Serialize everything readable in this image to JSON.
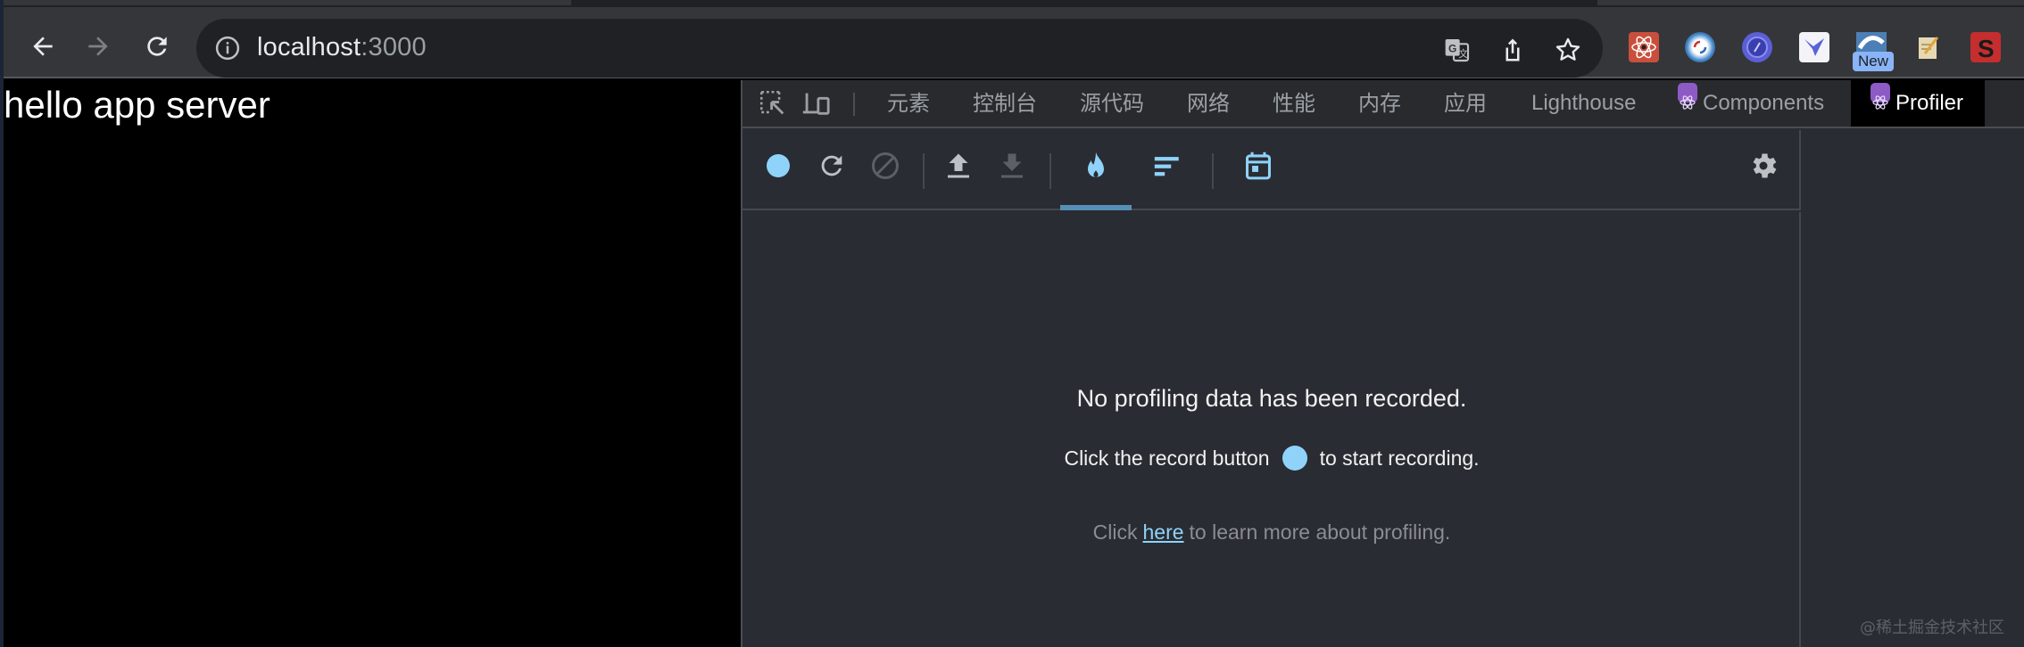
{
  "browser": {
    "url_host": "localhost",
    "url_port": ":3000",
    "nav": {
      "back": "arrow-left-icon",
      "forward": "arrow-right-icon",
      "reload": "reload-icon"
    },
    "omnibox_icons": [
      "translate-icon",
      "share-icon",
      "bookmark-star-icon"
    ],
    "extensions": [
      {
        "name": "react-devtools-extension",
        "color": "#c94f3c"
      },
      {
        "name": "sync-extension",
        "color": "#dfe7ef"
      },
      {
        "name": "compass-extension",
        "color": "#5b5fd6"
      },
      {
        "name": "bird-extension",
        "color": "#f3f3f8"
      },
      {
        "name": "wave-extension",
        "color": "#4c7fb5"
      },
      {
        "name": "notes-extension",
        "color": "#e6d8b2"
      },
      {
        "name": "s-extension",
        "color": "#c42e2e"
      }
    ],
    "new_badge": "New"
  },
  "page": {
    "heading": "hello app server"
  },
  "devtools": {
    "tabs": [
      {
        "label": "元素",
        "name": "tab-elements"
      },
      {
        "label": "控制台",
        "name": "tab-console"
      },
      {
        "label": "源代码",
        "name": "tab-sources"
      },
      {
        "label": "网络",
        "name": "tab-network"
      },
      {
        "label": "性能",
        "name": "tab-performance"
      },
      {
        "label": "内存",
        "name": "tab-memory"
      },
      {
        "label": "应用",
        "name": "tab-application"
      },
      {
        "label": "Lighthouse",
        "name": "tab-lighthouse"
      },
      {
        "label": "Components",
        "name": "tab-components"
      },
      {
        "label": "Profiler",
        "name": "tab-profiler",
        "active": true
      }
    ],
    "profiler": {
      "empty_title": "No profiling data has been recorded.",
      "record_prefix": "Click the record button",
      "record_suffix": "to start recording.",
      "learn_prefix": "Click",
      "learn_link": "here",
      "learn_suffix": "to learn more about profiling."
    }
  },
  "colors": {
    "accent_blue": "#8fd3fb",
    "react_purple": "#8e5ac4",
    "active_underline": "#558fb8"
  },
  "watermark": "@稀土掘金技术社区"
}
